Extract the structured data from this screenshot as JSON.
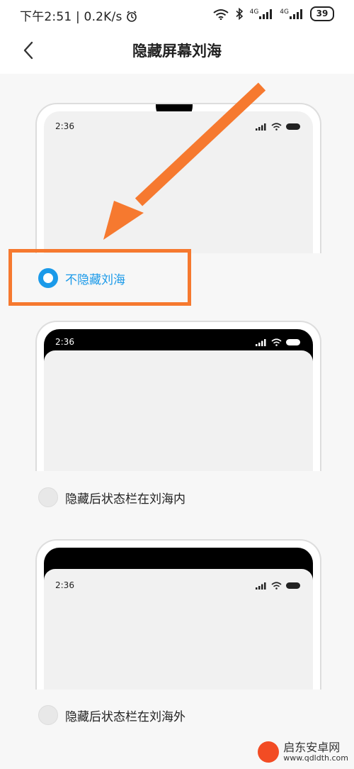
{
  "status_bar": {
    "time": "下午2:51",
    "separator": "|",
    "speed": "0.2K/s",
    "signal1_label": "4G",
    "signal2_label": "4G",
    "battery": "39"
  },
  "header": {
    "title": "隐藏屏幕刘海"
  },
  "previews": [
    {
      "time": "2:36"
    },
    {
      "time": "2:36"
    },
    {
      "time": "2:36"
    }
  ],
  "options": [
    {
      "label": "不隐藏刘海",
      "selected": true
    },
    {
      "label": "隐藏后状态栏在刘海内",
      "selected": false
    },
    {
      "label": "隐藏后状态栏在刘海外",
      "selected": false
    }
  ],
  "colors": {
    "accent": "#1b9ae9",
    "annotation": "#f6792f"
  },
  "watermark": {
    "name": "启东安卓网",
    "url": "www.qdldth.com"
  }
}
